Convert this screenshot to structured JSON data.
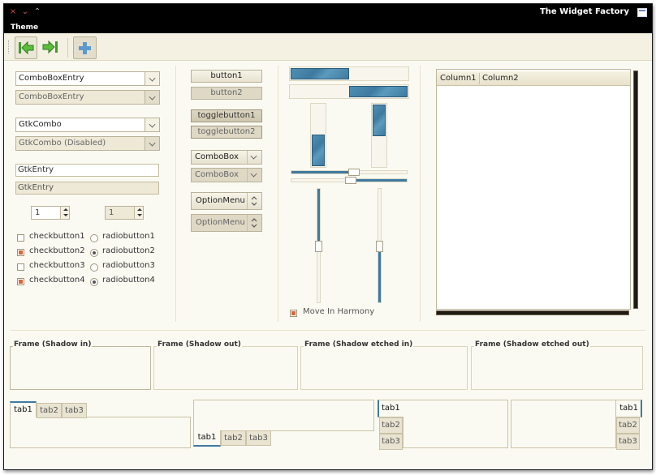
{
  "window": {
    "title": "The Widget Factory",
    "controls": {
      "close": "×",
      "minimize": "⌄",
      "maximize": "⌃"
    }
  },
  "menubar": {
    "items": [
      "Theme"
    ]
  },
  "toolbar": {
    "icons": [
      "go-first-icon",
      "go-next-icon",
      "add-icon"
    ]
  },
  "left_column": {
    "combobox_entry": "ComboBoxEntry",
    "combobox_entry_disabled": "ComboBoxEntry",
    "gtk_combo": "GtkCombo",
    "gtk_combo_disabled": "GtkCombo (Disabled)",
    "gtk_entry": "GtkEntry",
    "gtk_entry_disabled": "GtkEntry",
    "spin1": "1",
    "spin2": "1",
    "checkbuttons": [
      "checkbutton1",
      "checkbutton2",
      "checkbutton3",
      "checkbutton4"
    ],
    "radiobuttons": [
      "radiobutton1",
      "radiobutton2",
      "radiobutton3",
      "radiobutton4"
    ]
  },
  "buttons_column": {
    "button1": "button1",
    "button2": "button2",
    "togglebutton1": "togglebutton1",
    "togglebutton2": "togglebutton2",
    "combobox1": "ComboBox",
    "combobox2": "ComboBox",
    "optionmenu1": "OptionMenu",
    "optionmenu2": "OptionMenu"
  },
  "progress_column": {
    "move_in_harmony": "Move In Harmony"
  },
  "treeview": {
    "columns": [
      "Column1",
      "Column2"
    ]
  },
  "frames": [
    "Frame (Shadow in)",
    "Frame (Shadow out)",
    "Frame (Shadow etched in)",
    "Frame (Shadow etched out)"
  ],
  "notebooks": {
    "tabs": [
      "tab1",
      "tab2",
      "tab3"
    ]
  },
  "colors": {
    "accent": "#3f7aa0",
    "check": "#d8663c",
    "titlebar": "#000000",
    "background": "#fbfaf2"
  }
}
